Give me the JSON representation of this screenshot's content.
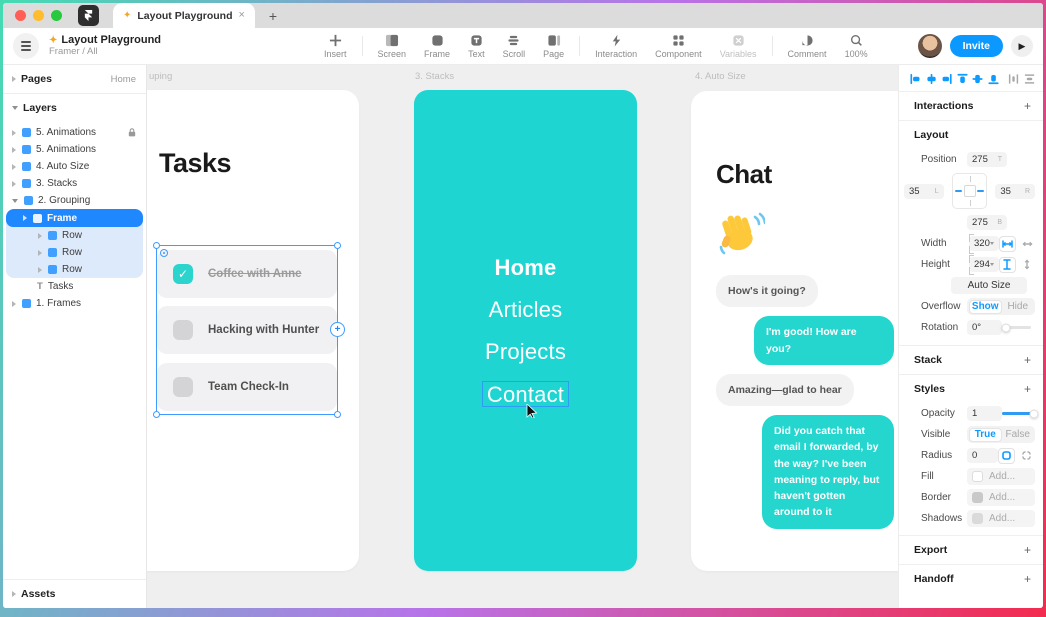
{
  "icons": {
    "sparkle": "✦",
    "plus": "+",
    "close": "×",
    "play": "▶",
    "check": "✓",
    "text_layer": "T",
    "new_tab": "+",
    "stack_plus": "+"
  },
  "window": {
    "tab_title": "Layout Playground"
  },
  "toolbar": {
    "title": "Layout Playground",
    "breadcrumb": "Framer / All",
    "invite": "Invite",
    "tools": [
      {
        "label": "Insert"
      },
      {
        "label": "Screen"
      },
      {
        "label": "Frame"
      },
      {
        "label": "Text"
      },
      {
        "label": "Scroll"
      },
      {
        "label": "Page"
      },
      {
        "label": "Interaction"
      },
      {
        "label": "Component"
      },
      {
        "label": "Variables"
      },
      {
        "label": "Comment"
      },
      {
        "label": "100%"
      }
    ]
  },
  "sidebar": {
    "pages_header": "Pages",
    "pages_current": "Home",
    "layers_header": "Layers",
    "assets_header": "Assets",
    "layers": [
      {
        "label": "5. Animations"
      },
      {
        "label": "5. Animations"
      },
      {
        "label": "4. Auto Size"
      },
      {
        "label": "3. Stacks"
      },
      {
        "label": "2. Grouping"
      },
      {
        "label": "Frame"
      },
      {
        "label": "Row"
      },
      {
        "label": "Row"
      },
      {
        "label": "Row"
      },
      {
        "label": "Tasks"
      },
      {
        "label": "1. Frames"
      }
    ]
  },
  "canvas": {
    "frame_labels": [
      {
        "text": "uping"
      },
      {
        "text": "3. Stacks"
      },
      {
        "text": "4. Auto Size"
      }
    ],
    "tasks": {
      "title": "Tasks",
      "items": [
        {
          "label": "Coffee with Anne"
        },
        {
          "label": "Hacking with Hunter"
        },
        {
          "label": "Team Check-In"
        }
      ]
    },
    "menu": {
      "items": [
        {
          "label": "Home"
        },
        {
          "label": "Articles"
        },
        {
          "label": "Projects"
        },
        {
          "label": "Contact"
        }
      ]
    },
    "chat": {
      "title": "Chat",
      "messages": [
        {
          "text": "How's it going?"
        },
        {
          "text": "I'm good! How are you?"
        },
        {
          "text": "Amazing—glad to hear"
        },
        {
          "text": "Did you catch that email I forwarded, by the way? I've been meaning to reply, but haven't gotten around to it"
        }
      ]
    }
  },
  "inspector": {
    "interactions": "Interactions",
    "layout": "Layout",
    "position_label": "Position",
    "pos_top": "275",
    "pos_left": "35",
    "pos_right": "35",
    "pos_bottom": "275",
    "suffix_top": "T",
    "suffix_left": "L",
    "suffix_right": "R",
    "suffix_bottom": "B",
    "width_label": "Width",
    "width": "320",
    "height_label": "Height",
    "height": "294",
    "auto_size": "Auto Size",
    "overflow_label": "Overflow",
    "show": "Show",
    "hide": "Hide",
    "rotation_label": "Rotation",
    "rotation": "0°",
    "stack": "Stack",
    "styles": "Styles",
    "opacity_label": "Opacity",
    "opacity": "1",
    "visible_label": "Visible",
    "visible_true": "True",
    "visible_false": "False",
    "radius_label": "Radius",
    "radius": "0",
    "fill_label": "Fill",
    "border_label": "Border",
    "shadows_label": "Shadows",
    "add": "Add...",
    "export": "Export",
    "handoff": "Handoff"
  },
  "colors": {
    "teal": "#1fd5d2",
    "bubble_teal": "#25d6cf",
    "accent_blue": "#0e9bff",
    "selection_blue": "#1f88fe",
    "invite_blue": "#0b99ff"
  }
}
